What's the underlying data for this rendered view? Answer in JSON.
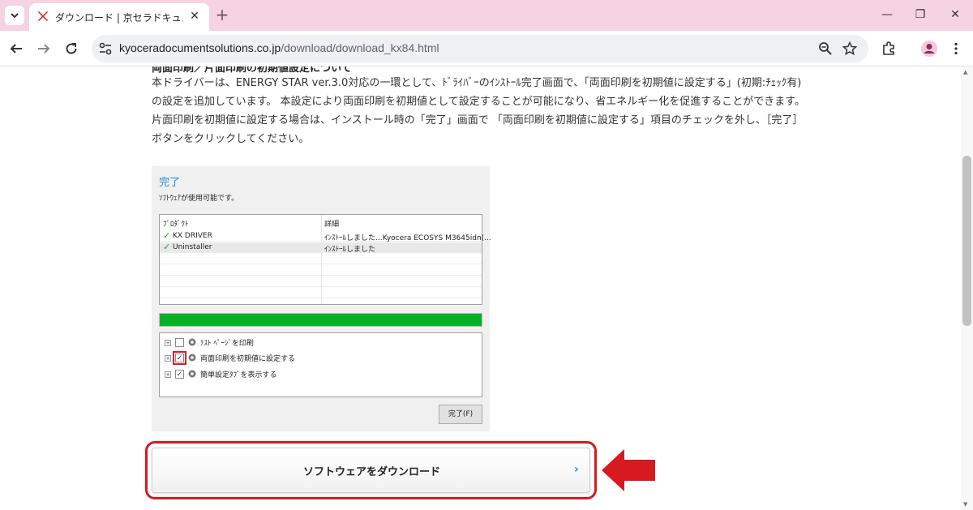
{
  "browser": {
    "tab": {
      "title": "ダウンロード | 京セラドキュメントソリ",
      "close_glyph": "✕"
    },
    "new_tab_glyph": "+",
    "url_host": "kyoceradocumentsolutions.co.jp",
    "url_path": "/download/download_kx84.html",
    "window_controls": {
      "minimize": "—",
      "restore": "❐",
      "close": "✕"
    },
    "colors": {
      "tabstrip": "#f5d3e2",
      "omnibox": "#eef0f3",
      "brand_red": "#d71920"
    }
  },
  "page": {
    "partial_heading": "両面印刷／片面印刷の初期値設定について",
    "paragraph": "本ドライバーは、ENERGY STAR ver.3.0対応の一環として、ﾄﾞﾗｲﾊﾞｰのｲﾝｽﾄｰﾙ完了画面で、「両面印刷を初期値に設定する」(初期:ﾁｪｯｸ有)の設定を追加しています。 本設定により両面印刷を初期値として設定することが可能になり、省エネルギー化を促進することができます。 片面印刷を初期値に設定する場合は、インストール時の「完了」画面で 「両面印刷を初期値に設定する」項目のチェックを外し、［完了］ボタンをクリックしてください。",
    "dialog": {
      "title": "完了",
      "subtitle": "ｿﾌﾄｳｪｱが使用可能です。",
      "columns": [
        "ﾌﾟﾛﾀﾞｸﾄ",
        "詳細"
      ],
      "rows": [
        {
          "product": "KX DRIVER",
          "detail": "ｲﾝｽﾄｰﾙしました...Kyocera ECOSYS M3645idn(..."
        },
        {
          "product": "Uninstaller",
          "detail": "ｲﾝｽﾄｰﾙしました"
        }
      ],
      "progress_fraction": 1.0,
      "options": [
        {
          "label": "ﾃｽﾄ ﾍﾟｰｼﾞを印刷",
          "checked": false,
          "highlighted": false
        },
        {
          "label": "両面印刷を初期値に設定する",
          "checked": true,
          "highlighted": true
        },
        {
          "label": "簡単設定ﾀﾌﾞを表示する",
          "checked": true,
          "highlighted": false
        }
      ],
      "done_button": "完了(F)",
      "check_glyph": "✓"
    },
    "download_button": {
      "label": "ソフトウェアをダウンロード",
      "chevron": "›"
    }
  }
}
